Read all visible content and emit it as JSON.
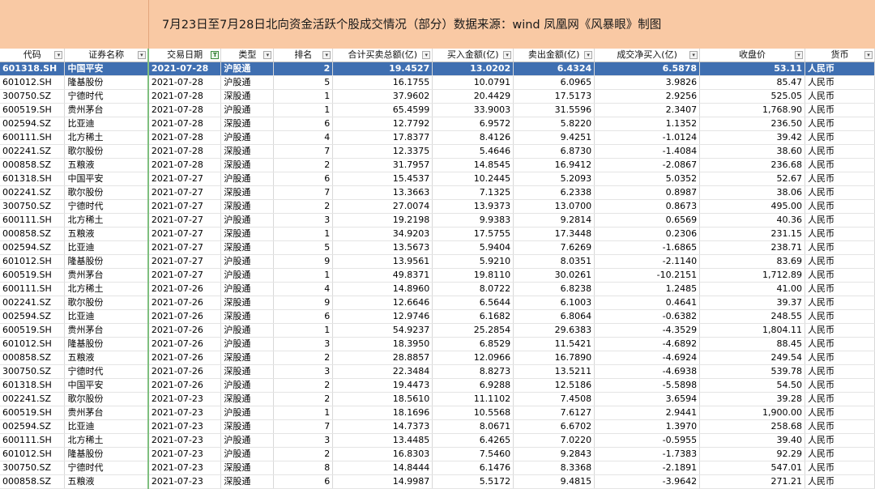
{
  "title": "7月23日至7月28日北向资金活跃个股成交情况（部分）数据来源：wind 凤凰网《风暴眼》制图",
  "headers": [
    "代码",
    "证券名称",
    "交易日期",
    "类型",
    "排名",
    "合计买卖总额(亿)",
    "买入金额(亿)",
    "卖出金额(亿)",
    "成交净买入(亿)",
    "收盘价",
    "货币"
  ],
  "filters": [
    "dropdown",
    "dropdown",
    "active",
    "dropdown",
    "dropdown",
    "dropdown",
    "dropdown",
    "dropdown",
    "dropdown",
    "dropdown",
    "dropdown"
  ],
  "rows": [
    [
      "601318.SH",
      "中国平安",
      "2021-07-28",
      "沪股通",
      "2",
      "19.4527",
      "13.0202",
      "6.4324",
      "6.5878",
      "53.11",
      "人民币"
    ],
    [
      "601012.SH",
      "隆基股份",
      "2021-07-28",
      "沪股通",
      "5",
      "16.1755",
      "10.0791",
      "6.0965",
      "3.9826",
      "85.47",
      "人民币"
    ],
    [
      "300750.SZ",
      "宁德时代",
      "2021-07-28",
      "深股通",
      "1",
      "37.9602",
      "20.4429",
      "17.5173",
      "2.9256",
      "525.05",
      "人民币"
    ],
    [
      "600519.SH",
      "贵州茅台",
      "2021-07-28",
      "沪股通",
      "1",
      "65.4599",
      "33.9003",
      "31.5596",
      "2.3407",
      "1,768.90",
      "人民币"
    ],
    [
      "002594.SZ",
      "比亚迪",
      "2021-07-28",
      "深股通",
      "6",
      "12.7792",
      "6.9572",
      "5.8220",
      "1.1352",
      "236.50",
      "人民币"
    ],
    [
      "600111.SH",
      "北方稀土",
      "2021-07-28",
      "沪股通",
      "4",
      "17.8377",
      "8.4126",
      "9.4251",
      "-1.0124",
      "39.42",
      "人民币"
    ],
    [
      "002241.SZ",
      "歌尔股份",
      "2021-07-28",
      "深股通",
      "7",
      "12.3375",
      "5.4646",
      "6.8730",
      "-1.4084",
      "38.60",
      "人民币"
    ],
    [
      "000858.SZ",
      "五粮液",
      "2021-07-28",
      "深股通",
      "2",
      "31.7957",
      "14.8545",
      "16.9412",
      "-2.0867",
      "236.68",
      "人民币"
    ],
    [
      "601318.SH",
      "中国平安",
      "2021-07-27",
      "沪股通",
      "6",
      "15.4537",
      "10.2445",
      "5.2093",
      "5.0352",
      "52.67",
      "人民币"
    ],
    [
      "002241.SZ",
      "歌尔股份",
      "2021-07-27",
      "深股通",
      "7",
      "13.3663",
      "7.1325",
      "6.2338",
      "0.8987",
      "38.06",
      "人民币"
    ],
    [
      "300750.SZ",
      "宁德时代",
      "2021-07-27",
      "深股通",
      "2",
      "27.0074",
      "13.9373",
      "13.0700",
      "0.8673",
      "495.00",
      "人民币"
    ],
    [
      "600111.SH",
      "北方稀土",
      "2021-07-27",
      "沪股通",
      "3",
      "19.2198",
      "9.9383",
      "9.2814",
      "0.6569",
      "40.36",
      "人民币"
    ],
    [
      "000858.SZ",
      "五粮液",
      "2021-07-27",
      "深股通",
      "1",
      "34.9203",
      "17.5755",
      "17.3448",
      "0.2306",
      "231.15",
      "人民币"
    ],
    [
      "002594.SZ",
      "比亚迪",
      "2021-07-27",
      "深股通",
      "5",
      "13.5673",
      "5.9404",
      "7.6269",
      "-1.6865",
      "238.71",
      "人民币"
    ],
    [
      "601012.SH",
      "隆基股份",
      "2021-07-27",
      "沪股通",
      "9",
      "13.9561",
      "5.9210",
      "8.0351",
      "-2.1140",
      "83.69",
      "人民币"
    ],
    [
      "600519.SH",
      "贵州茅台",
      "2021-07-27",
      "沪股通",
      "1",
      "49.8371",
      "19.8110",
      "30.0261",
      "-10.2151",
      "1,712.89",
      "人民币"
    ],
    [
      "600111.SH",
      "北方稀土",
      "2021-07-26",
      "沪股通",
      "4",
      "14.8960",
      "8.0722",
      "6.8238",
      "1.2485",
      "41.00",
      "人民币"
    ],
    [
      "002241.SZ",
      "歌尔股份",
      "2021-07-26",
      "深股通",
      "9",
      "12.6646",
      "6.5644",
      "6.1003",
      "0.4641",
      "39.37",
      "人民币"
    ],
    [
      "002594.SZ",
      "比亚迪",
      "2021-07-26",
      "深股通",
      "6",
      "12.9746",
      "6.1682",
      "6.8064",
      "-0.6382",
      "248.55",
      "人民币"
    ],
    [
      "600519.SH",
      "贵州茅台",
      "2021-07-26",
      "沪股通",
      "1",
      "54.9237",
      "25.2854",
      "29.6383",
      "-4.3529",
      "1,804.11",
      "人民币"
    ],
    [
      "601012.SH",
      "隆基股份",
      "2021-07-26",
      "沪股通",
      "3",
      "18.3950",
      "6.8529",
      "11.5421",
      "-4.6892",
      "88.45",
      "人民币"
    ],
    [
      "000858.SZ",
      "五粮液",
      "2021-07-26",
      "深股通",
      "2",
      "28.8857",
      "12.0966",
      "16.7890",
      "-4.6924",
      "249.54",
      "人民币"
    ],
    [
      "300750.SZ",
      "宁德时代",
      "2021-07-26",
      "深股通",
      "3",
      "22.3484",
      "8.8273",
      "13.5211",
      "-4.6938",
      "539.78",
      "人民币"
    ],
    [
      "601318.SH",
      "中国平安",
      "2021-07-26",
      "沪股通",
      "2",
      "19.4473",
      "6.9288",
      "12.5186",
      "-5.5898",
      "54.50",
      "人民币"
    ],
    [
      "002241.SZ",
      "歌尔股份",
      "2021-07-23",
      "深股通",
      "2",
      "18.5610",
      "11.1102",
      "7.4508",
      "3.6594",
      "39.28",
      "人民币"
    ],
    [
      "600519.SH",
      "贵州茅台",
      "2021-07-23",
      "沪股通",
      "1",
      "18.1696",
      "10.5568",
      "7.6127",
      "2.9441",
      "1,900.00",
      "人民币"
    ],
    [
      "002594.SZ",
      "比亚迪",
      "2021-07-23",
      "深股通",
      "7",
      "14.7373",
      "8.0671",
      "6.6702",
      "1.3970",
      "258.68",
      "人民币"
    ],
    [
      "600111.SH",
      "北方稀土",
      "2021-07-23",
      "沪股通",
      "3",
      "13.4485",
      "6.4265",
      "7.0220",
      "-0.5955",
      "39.40",
      "人民币"
    ],
    [
      "601012.SH",
      "隆基股份",
      "2021-07-23",
      "沪股通",
      "2",
      "16.8303",
      "7.5460",
      "9.2843",
      "-1.7383",
      "92.29",
      "人民币"
    ],
    [
      "300750.SZ",
      "宁德时代",
      "2021-07-23",
      "深股通",
      "8",
      "14.8444",
      "6.1476",
      "8.3368",
      "-2.1891",
      "547.01",
      "人民币"
    ],
    [
      "000858.SZ",
      "五粮液",
      "2021-07-23",
      "深股通",
      "6",
      "14.9987",
      "5.5172",
      "9.4815",
      "-3.9642",
      "271.21",
      "人民币"
    ]
  ],
  "selected_row": 0,
  "colors": {
    "title_band": "#f9c9a4",
    "selection": "#3f6fb1"
  }
}
